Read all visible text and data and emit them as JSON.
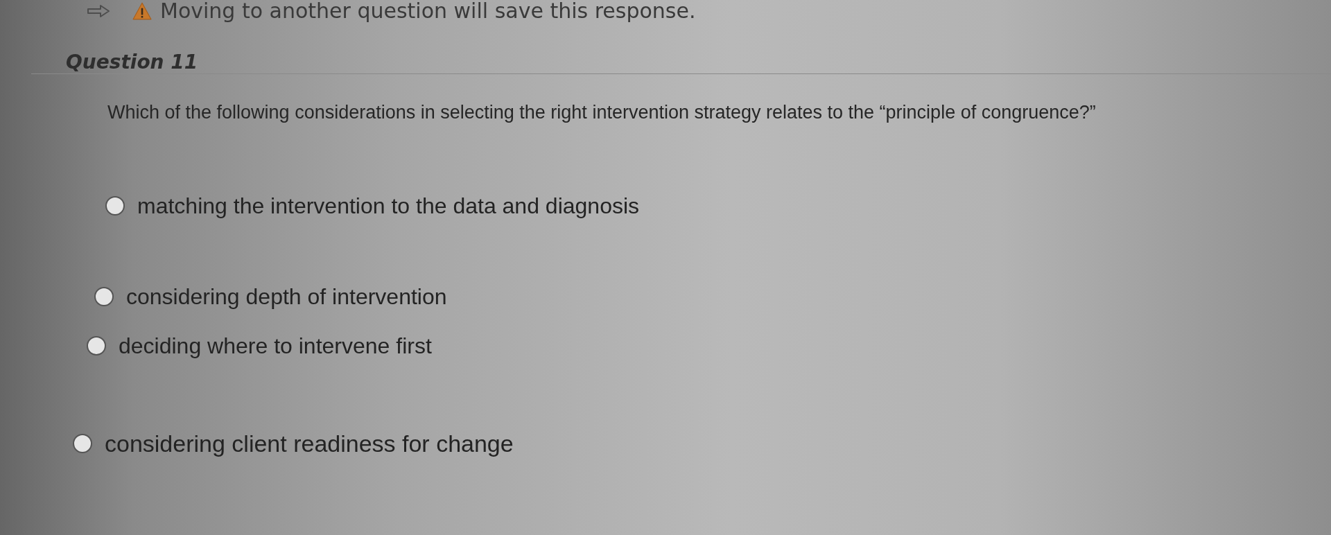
{
  "notice": {
    "text": "Moving to another question will save this response."
  },
  "question": {
    "title": "Question 11",
    "prompt": "Which of the following considerations in selecting the right intervention strategy relates to the “principle of congruence?”"
  },
  "options": [
    {
      "label": "matching the intervention to the data and diagnosis",
      "selected": false
    },
    {
      "label": "considering depth of intervention",
      "selected": false
    },
    {
      "label": "deciding where to intervene first",
      "selected": false
    },
    {
      "label": "considering client readiness for change",
      "selected": false
    }
  ]
}
